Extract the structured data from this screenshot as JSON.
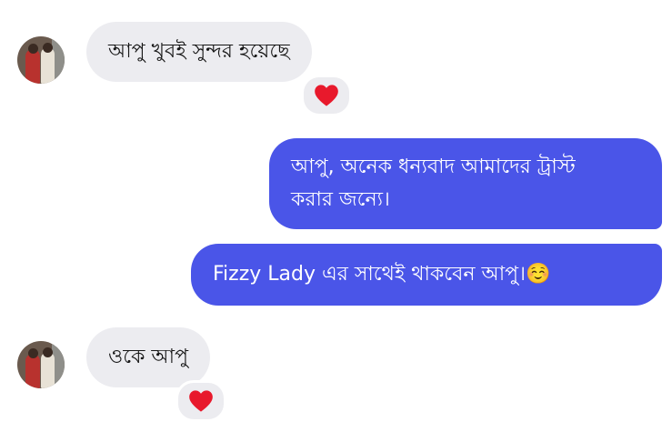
{
  "messages": {
    "m1": {
      "text": "আপু খুবই  সুন্দর হয়েছে",
      "reaction": "heart-icon"
    },
    "m2": {
      "line1": "আপু, অনেক ধন্যবাদ আমাদের ট্রাস্ট",
      "line2": "করার জন্যে।"
    },
    "m3": {
      "text": "Fizzy Lady এর সাথেই থাকবেন আপু।☺️"
    },
    "m4": {
      "text": "ওকে  আপু",
      "reaction": "heart-icon"
    }
  },
  "colors": {
    "incoming_bubble": "#ececf0",
    "outgoing_bubble": "#4a55e8",
    "heart": "#e8192c"
  }
}
